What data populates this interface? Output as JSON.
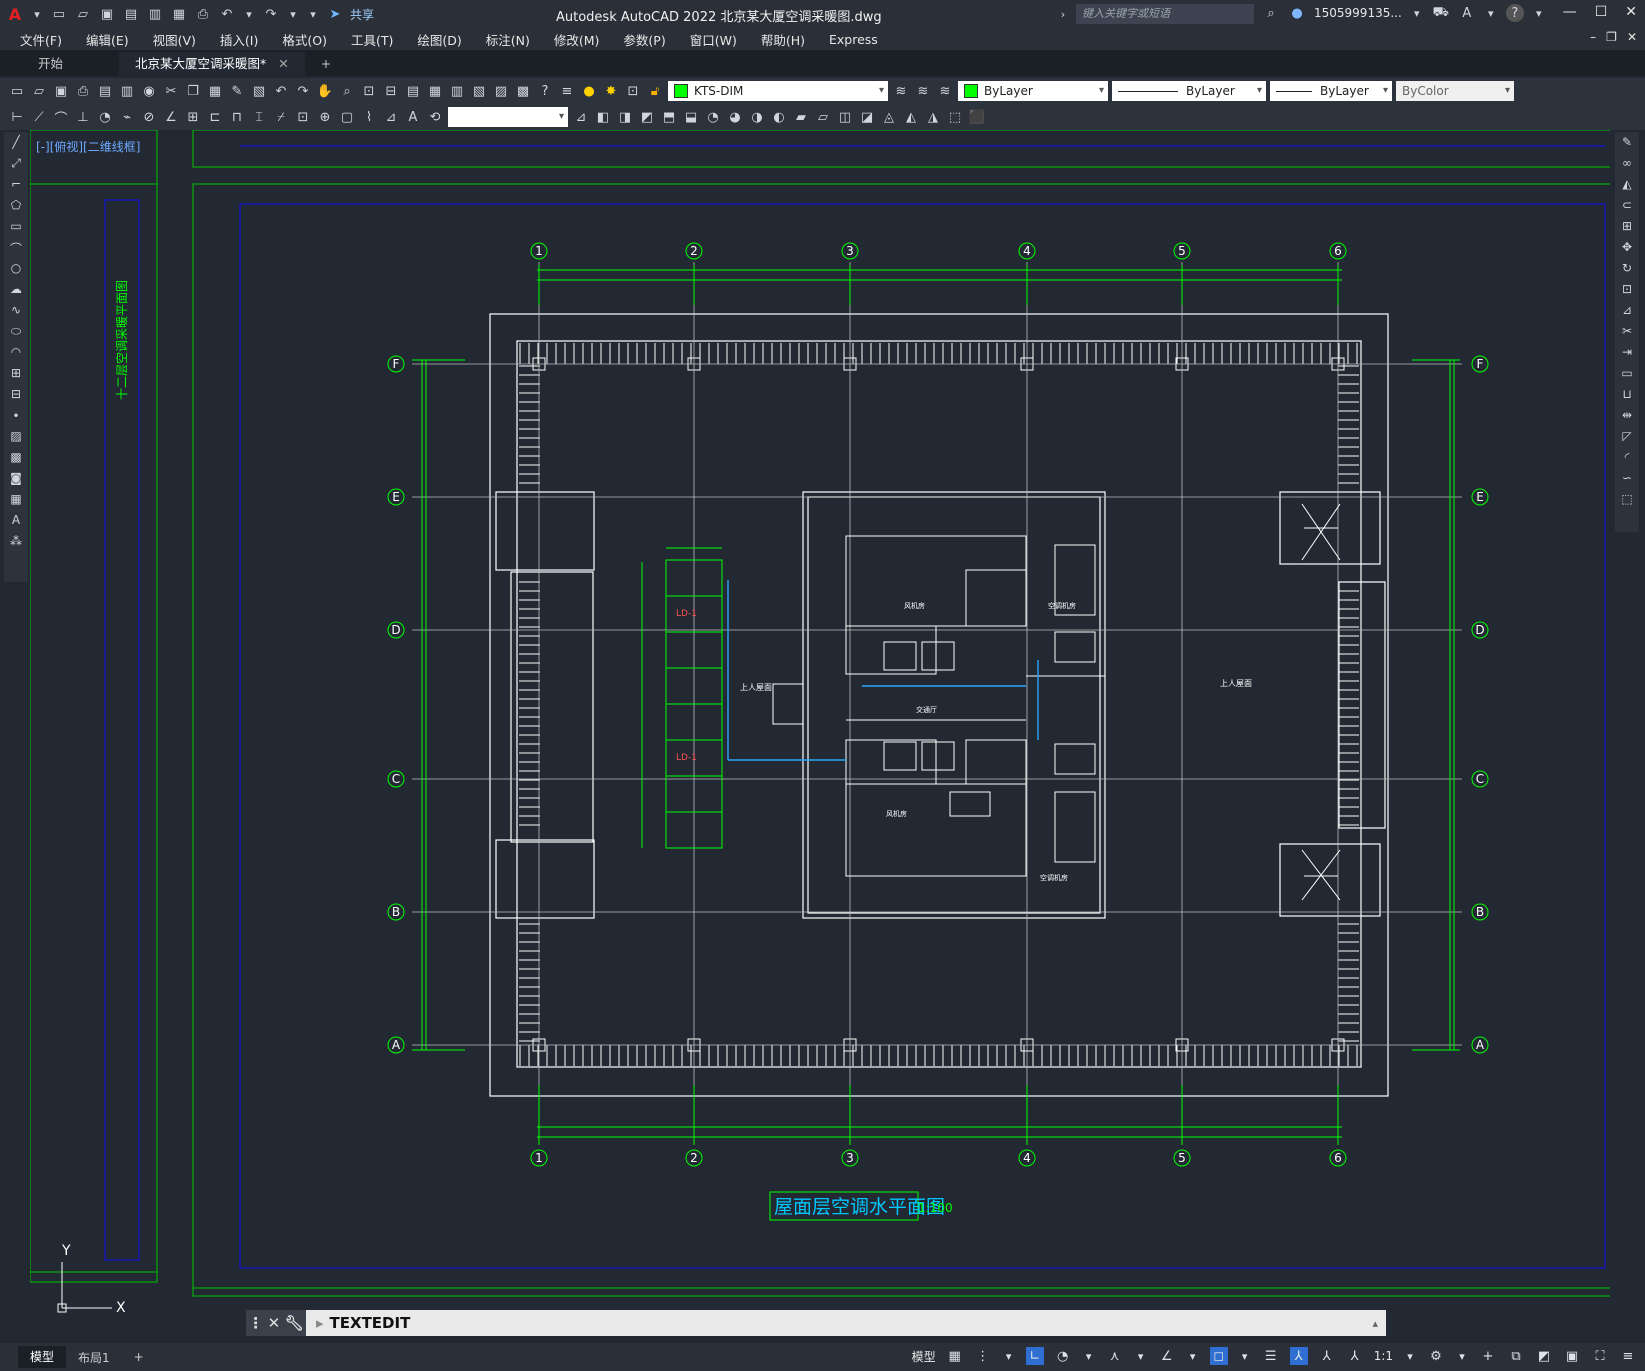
{
  "app": {
    "title": "Autodesk AutoCAD 2022    北京某大厦空调采暖图.dwg",
    "share_label": "共享",
    "search_placeholder": "键入关键字或短语",
    "user": "1505999135...",
    "help": "?"
  },
  "menu": [
    "文件(F)",
    "编辑(E)",
    "视图(V)",
    "插入(I)",
    "格式(O)",
    "工具(T)",
    "绘图(D)",
    "标注(N)",
    "修改(M)",
    "参数(P)",
    "窗口(W)",
    "帮助(H)",
    "Express"
  ],
  "tabs": {
    "start": "开始",
    "doc": "北京某大厦空调采暖图*",
    "close": "✕",
    "add": "+"
  },
  "toolbar": {
    "layer_name": "KTS-DIM",
    "color": "ByLayer",
    "linetype": "ByLayer",
    "lineweight": "ByLayer",
    "plotstyle": "ByColor",
    "textstyle": ""
  },
  "viewport_label": "[-][俯视][二维线框]",
  "drawing": {
    "title": "屋面层空调水平面图",
    "scale": "1:100",
    "col_labels": [
      "1",
      "2",
      "3",
      "4",
      "5",
      "6"
    ],
    "row_labels": [
      "F",
      "E",
      "D",
      "C",
      "B",
      "A"
    ],
    "room_labels": [
      "上人屋面",
      "上人屋面",
      "风机房",
      "风机房",
      "空调机房",
      "空调机房",
      "交通厅"
    ],
    "pipe_labels": [
      "LD-1",
      "LD-1"
    ],
    "side_text": "十二层空调采暖平面图"
  },
  "ucs": {
    "x": "X",
    "y": "Y"
  },
  "command": {
    "text": "TEXTEDIT"
  },
  "status": {
    "model_tab": "模型",
    "layout_tab": "布局1",
    "add": "+",
    "model_btn": "模型",
    "scale": "1:1"
  },
  "colors": {
    "accent": "#00ff00",
    "grid": "#bfbfbf",
    "wall": "#ffffff",
    "frame": "#0000c8",
    "pipe": "#2aa6ff"
  }
}
